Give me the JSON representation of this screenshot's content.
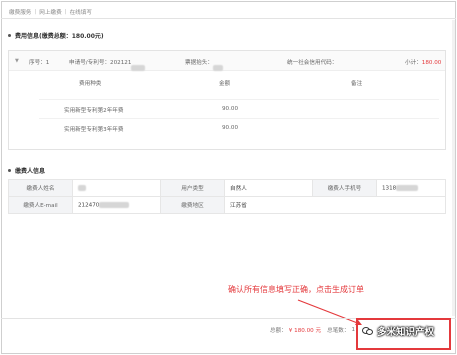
{
  "breadcrumb": [
    "缴费服务",
    "网上缴费",
    "在线填写"
  ],
  "fee_section": {
    "title": "费用信息(缴费总额：180.00元)",
    "header": {
      "seq_label": "序号：1",
      "app_no_label": "申请号/专利号：202121",
      "invoice_label": "票据抬头：",
      "credit_code_label": "统一社会信用代码：",
      "subtotal_label": "小计：",
      "subtotal_amount": "180.00"
    },
    "columns": [
      "费用种类",
      "金额",
      "备注"
    ],
    "rows": [
      {
        "type": "实用新型专利第2年年费",
        "amount": "90.00",
        "note": ""
      },
      {
        "type": "实用新型专利第3年年费",
        "amount": "90.00",
        "note": ""
      }
    ]
  },
  "payer_section": {
    "title": "缴费人信息",
    "labels": {
      "name": "缴费人姓名",
      "user_type": "用户类型",
      "phone": "缴费人手机号",
      "email": "缴费人E-mail",
      "region": "缴费地区"
    },
    "values": {
      "name": "",
      "user_type": "自然人",
      "phone": "1318",
      "email": "212470",
      "region": "江苏省"
    }
  },
  "callout": "确认所有信息填写正确，点击生成订单",
  "bottom": {
    "total_label": "总额：",
    "total_amount": "¥ 180.00 元",
    "count_label": "总笔数：",
    "count": "1"
  },
  "watermark": "多米知识产权",
  "colors": {
    "accent": "#e4393c"
  }
}
